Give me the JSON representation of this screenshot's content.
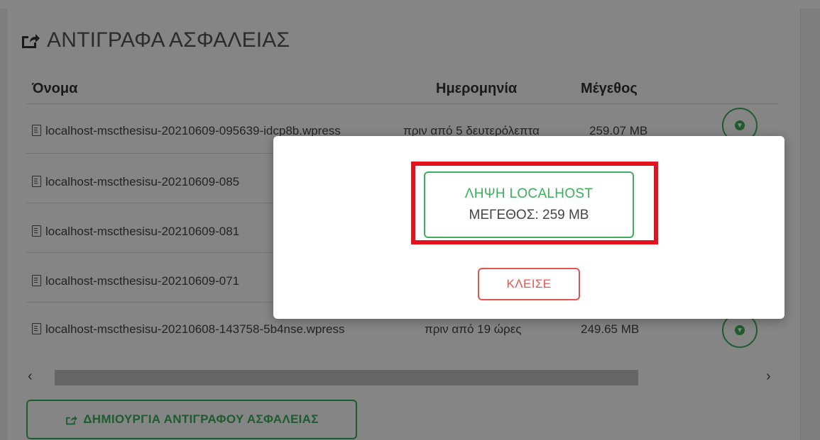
{
  "colors": {
    "accent_green": "#3cae5c",
    "danger_red": "#e8524c",
    "highlight_red": "#e5121c"
  },
  "panel": {
    "title": "ΑΝΤΙΓΡΑΦΑ ΑΣΦΑΛΕΙΑΣ",
    "title_icon": "share-square-icon"
  },
  "table": {
    "headers": {
      "name": "Όνομα",
      "date": "Ημερομηνία",
      "size": "Μέγεθος"
    },
    "rows": [
      {
        "name": "localhost-mscthesisu-20210609-095639-idcp8b.wpress",
        "date": "πριν από 5 δευτερόλεπτα",
        "size": "259.07 MB"
      },
      {
        "name": "localhost-mscthesisu-20210609-085",
        "date": "",
        "size": ""
      },
      {
        "name": "localhost-mscthesisu-20210609-081",
        "date": "",
        "size": ""
      },
      {
        "name": "localhost-mscthesisu-20210609-071",
        "date": "",
        "size": ""
      },
      {
        "name": "localhost-mscthesisu-20210608-143758-5b4nse.wpress",
        "date": "πριν από 19 ώρες",
        "size": "249.65 MB"
      }
    ]
  },
  "scroll": {
    "left": "‹",
    "right": "›"
  },
  "create_button": {
    "label": "ΔΗΜΙΟΥΡΓΙΑ ΑΝΤΙΓΡΑΦΟΥ ΑΣΦΑΛΕΙΑΣ"
  },
  "modal": {
    "download_line1": "ΛΗΨΗ LOCALHOST",
    "download_line2": "ΜΕΓΕΘΟΣ: 259 MB",
    "close_label": "ΚΛΕΙΣΕ"
  }
}
